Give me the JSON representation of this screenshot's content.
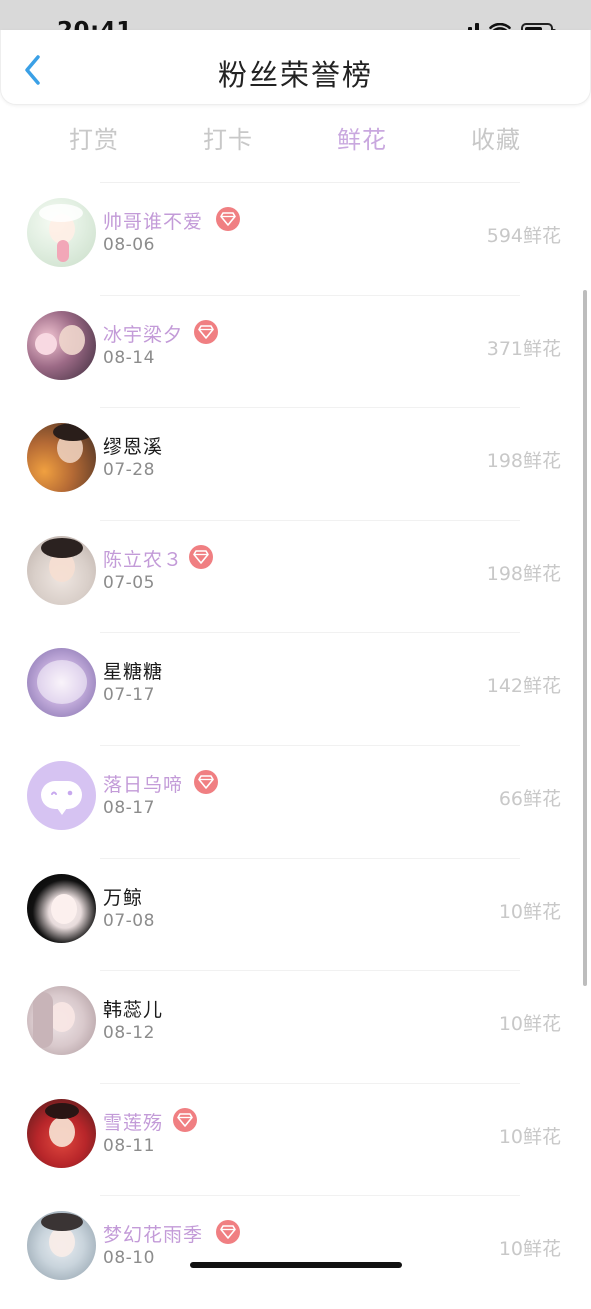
{
  "status_bar": {
    "time": "20:41"
  },
  "header": {
    "title": "粉丝荣誉榜",
    "back_icon": "chevron-left-icon",
    "accent_color": "#3aa0e6"
  },
  "tabs": [
    {
      "label": "打赏",
      "active": false
    },
    {
      "label": "打卡",
      "active": false
    },
    {
      "label": "鲜花",
      "active": true
    },
    {
      "label": "收藏",
      "active": false
    }
  ],
  "colors": {
    "tab_active": "#c9a8df",
    "vip_name": "#c39bd8",
    "vip_badge": "#f07f82",
    "count_text": "#c8c8c8"
  },
  "fans": [
    {
      "name": "帅哥谁不爱",
      "date": "08-06",
      "count": "594鲜花",
      "vip": true
    },
    {
      "name": "冰宇梁夕",
      "date": "08-14",
      "count": "371鲜花",
      "vip": true
    },
    {
      "name": "缪恩溪",
      "date": "07-28",
      "count": "198鲜花",
      "vip": false
    },
    {
      "name": "陈立农３",
      "date": "07-05",
      "count": "198鲜花",
      "vip": true
    },
    {
      "name": "星糖糖",
      "date": "07-17",
      "count": "142鲜花",
      "vip": false
    },
    {
      "name": "落日乌啼",
      "date": "08-17",
      "count": "66鲜花",
      "vip": true
    },
    {
      "name": "万鲸",
      "date": "07-08",
      "count": "10鲜花",
      "vip": false
    },
    {
      "name": "韩蕊儿",
      "date": "08-12",
      "count": "10鲜花",
      "vip": false
    },
    {
      "name": "雪莲殇",
      "date": "08-11",
      "count": "10鲜花",
      "vip": true
    },
    {
      "name": "梦幻花雨季",
      "date": "08-10",
      "count": "10鲜花",
      "vip": true
    }
  ]
}
